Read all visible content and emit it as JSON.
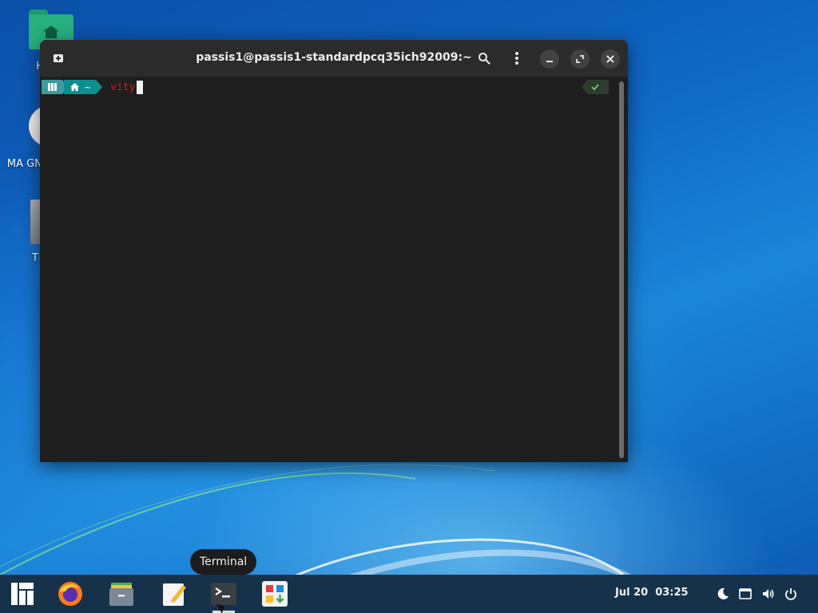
{
  "desktop": {
    "icons": [
      {
        "label": "H",
        "name": "home"
      },
      {
        "label": "MA GNO",
        "name": "manjaro-gnome"
      },
      {
        "label": "T",
        "name": "trash"
      }
    ]
  },
  "terminal": {
    "title": "passis1@passis1-standardpcq35ich92009:~",
    "prompt": {
      "path": "~",
      "command": "vity"
    },
    "status_icon": "check-icon",
    "colors": {
      "background": "#1e1e1e",
      "titlebar": "#2b2b2b",
      "command": "#cc1f1f",
      "prompt_segment": "#0b8f8f"
    }
  },
  "tooltip": {
    "text": "Terminal"
  },
  "taskbar": {
    "items": [
      {
        "name": "manjaro-menu",
        "icon": "manjaro-logo-icon"
      },
      {
        "name": "firefox",
        "icon": "firefox-icon"
      },
      {
        "name": "files",
        "icon": "file-cabinet-icon"
      },
      {
        "name": "text-editor",
        "icon": "pencil-icon"
      },
      {
        "name": "terminal",
        "icon": "terminal-icon",
        "active": true
      },
      {
        "name": "software",
        "icon": "software-store-icon"
      }
    ],
    "clock": "Jul 20  03:25",
    "tray": [
      "moon-icon",
      "keyboard-icon",
      "volume-icon",
      "power-icon"
    ]
  }
}
